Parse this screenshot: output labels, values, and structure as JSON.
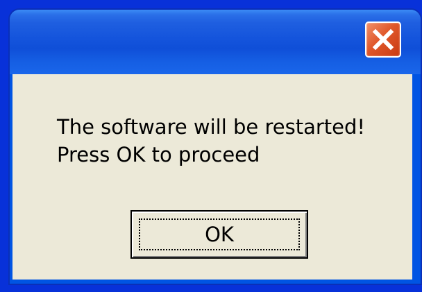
{
  "window": {
    "close_icon": "close-icon",
    "colors": {
      "titlebar": "#1f5fe0",
      "close_button": "#e0572a",
      "client_background": "#ece9d8",
      "desktop": "#0831d9"
    }
  },
  "message": {
    "line1": "The software will be restarted!",
    "line2": "Press OK to proceed"
  },
  "buttons": {
    "ok_label": "OK"
  }
}
